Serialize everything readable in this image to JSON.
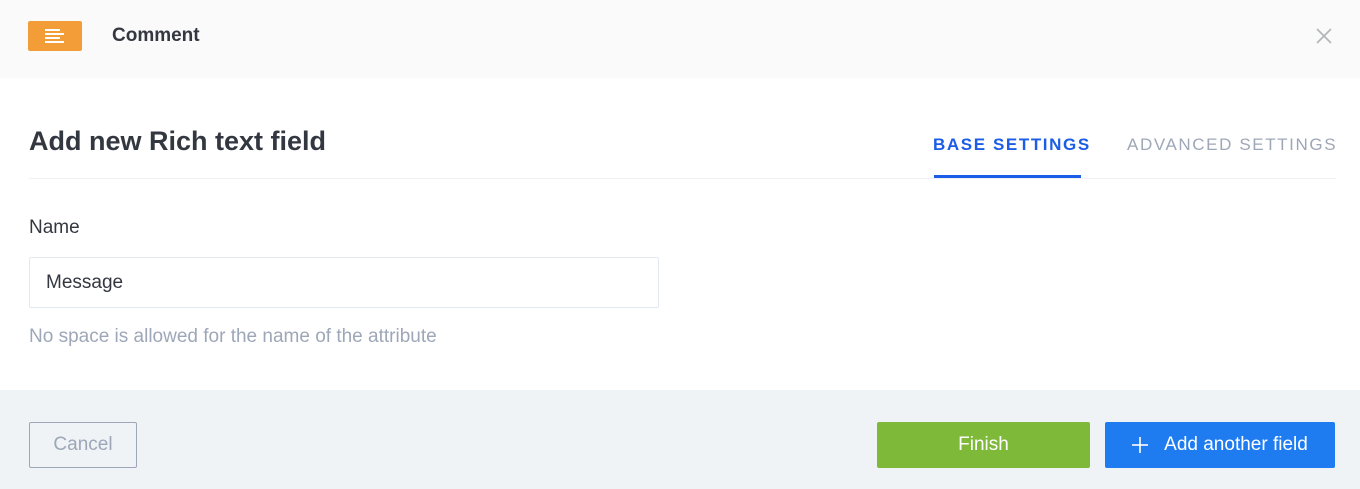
{
  "header": {
    "title": "Comment",
    "type_icon": "rich-text-icon",
    "close_icon": "close-icon",
    "accent_color": "#f29d38"
  },
  "main": {
    "title": "Add new Rich text field",
    "tabs": [
      {
        "label": "BASE SETTINGS",
        "active": true
      },
      {
        "label": "ADVANCED SETTINGS",
        "active": false
      }
    ],
    "name_field": {
      "label": "Name",
      "value": "Message",
      "hint": "No space is allowed for the name of the attribute"
    }
  },
  "footer": {
    "cancel_label": "Cancel",
    "finish_label": "Finish",
    "add_label": "Add another field",
    "finish_color": "#7fb93a",
    "add_color": "#1e7cf0"
  }
}
